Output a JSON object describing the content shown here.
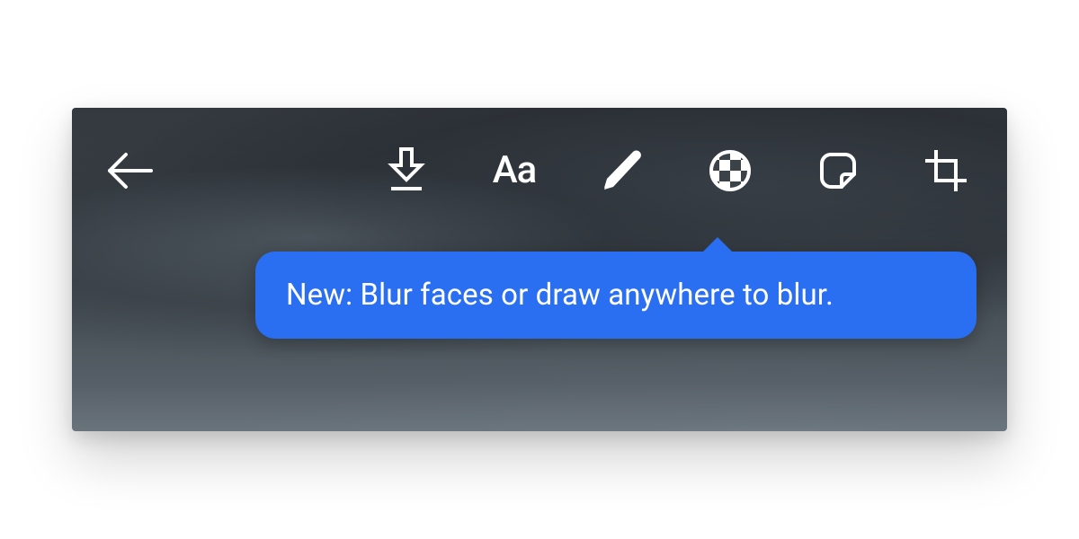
{
  "tooltip": {
    "text": "New: Blur faces or draw anywhere to blur."
  },
  "icons": {
    "back": "back-arrow",
    "download": "download",
    "text": "Aa",
    "draw": "pen",
    "blur": "blur-checker",
    "sticker": "sticker",
    "crop": "crop"
  },
  "colors": {
    "tooltip_bg": "#2a6ff1",
    "icon": "#ffffff"
  }
}
